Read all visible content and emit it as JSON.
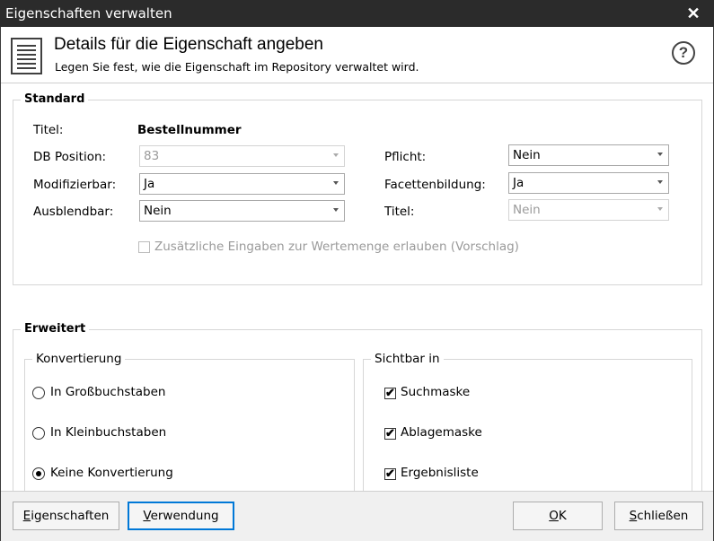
{
  "window": {
    "title": "Eigenschaften verwalten",
    "close_glyph": "✕"
  },
  "header": {
    "icon": "document-icon",
    "title": "Details für die Eigenschaft angeben",
    "subtitle": "Legen Sie fest, wie die Eigenschaft im Repository verwaltet wird.",
    "help_glyph": "?"
  },
  "standard": {
    "legend": "Standard",
    "titel_label": "Titel:",
    "titel_value": "Bestellnummer",
    "db_position_label": "DB Position:",
    "db_position_value": "83",
    "modifizierbar_label": "Modifizierbar:",
    "modifizierbar_value": "Ja",
    "ausblendbar_label": "Ausblendbar:",
    "ausblendbar_value": "Nein",
    "pflicht_label": "Pflicht:",
    "pflicht_value": "Nein",
    "facetten_label": "Facettenbildung:",
    "facetten_value": "Ja",
    "titel2_label": "Titel:",
    "titel2_value": "Nein",
    "zusatz_label": "Zusätzliche Eingaben zur Wertemenge erlauben (Vorschlag)"
  },
  "erweitert": {
    "legend": "Erweitert",
    "konvertierung": {
      "legend": "Konvertierung",
      "options": [
        {
          "label": "In Großbuchstaben",
          "selected": false
        },
        {
          "label": "In Kleinbuchstaben",
          "selected": false
        },
        {
          "label": "Keine Konvertierung",
          "selected": true
        }
      ]
    },
    "sichtbar": {
      "legend": "Sichtbar in",
      "options": [
        {
          "label": "Suchmaske",
          "checked": true
        },
        {
          "label": "Ablagemaske",
          "checked": true
        },
        {
          "label": "Ergebnisliste",
          "checked": true
        }
      ]
    }
  },
  "footer": {
    "eigenschaften_first": "E",
    "eigenschaften_rest": "igenschaften",
    "verwendung_first": "V",
    "verwendung_rest": "erwendung",
    "ok_first": "O",
    "ok_rest": "K",
    "schliessen_first": "S",
    "schliessen_rest": "chließen"
  },
  "colors": {
    "titlebar": "#2b2b2b",
    "focus_border": "#0078d7",
    "footer_bg": "#f0f0f0"
  }
}
